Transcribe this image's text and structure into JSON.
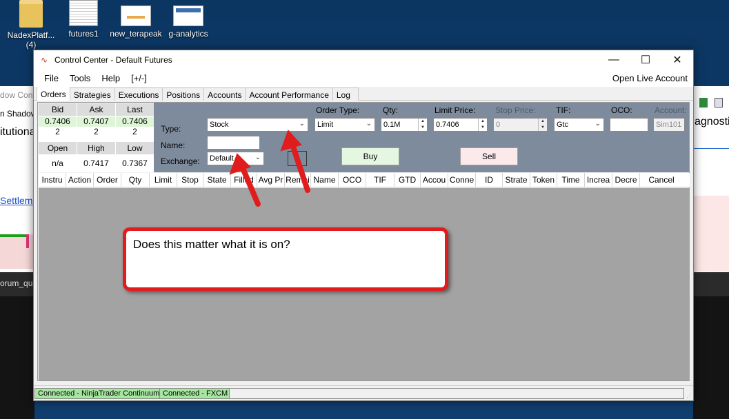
{
  "desktop": {
    "icons": [
      {
        "label": "NadexPlatf...",
        "sub": "(4)"
      },
      {
        "label": "futures1"
      },
      {
        "label": "new_terapeak"
      },
      {
        "label": "g-analytics"
      }
    ],
    "bg_left_texts": [
      "dow Con",
      "n Shadow",
      "itutional",
      "Settleme",
      "orum_qu"
    ],
    "bg_right_texts": [
      "agnosti"
    ]
  },
  "window": {
    "title": "Control Center - Default Futures",
    "menu": [
      "File",
      "Tools",
      "Help",
      "[+/-]"
    ],
    "menu_right": "Open Live Account",
    "tabs": [
      "Orders",
      "Strategies",
      "Executions",
      "Positions",
      "Accounts",
      "Account Performance",
      "Log"
    ],
    "active_tab": "Orders"
  },
  "quote": {
    "headers1": [
      "Bid",
      "Ask",
      "Last"
    ],
    "prices": [
      "0.7406",
      "0.7407",
      "0.7406"
    ],
    "sizes": [
      "2",
      "2",
      "2"
    ],
    "headers2": [
      "Open",
      "High",
      "Low"
    ],
    "values2": [
      "n/a",
      "0.7417",
      "0.7367"
    ]
  },
  "order": {
    "type_label": "Type:",
    "type_value": "Stock",
    "name_label": "Name:",
    "name_value": "",
    "exchange_label": "Exchange:",
    "exchange_value": "Default",
    "order_type_label": "Order Type:",
    "order_type_value": "Limit",
    "qty_label": "Qty:",
    "qty_value": "0.1M",
    "limit_price_label": "Limit Price:",
    "limit_price_value": "0.7406",
    "stop_price_label": "Stop Price:",
    "stop_price_value": "0",
    "tif_label": "TIF:",
    "tif_value": "Gtc",
    "oco_label": "OCO:",
    "oco_value": "",
    "account_label": "Account:",
    "account_value": "Sim101",
    "buy_label": "Buy",
    "sell_label": "Sell"
  },
  "grid_columns": [
    "Instru",
    "Action",
    "Order",
    "Qty",
    "Limit",
    "Stop",
    "State",
    "Filled",
    "Avg Pr",
    "Remai",
    "Name",
    "OCO",
    "TIF",
    "GTD",
    "Accou",
    "Conne",
    "ID",
    "Strate",
    "Token",
    "Time",
    "Increa",
    "Decre",
    "Cancel"
  ],
  "status": {
    "conn1": "Connected - NinjaTrader Continuum",
    "conn2": "Connected - FXCM"
  },
  "annotation": {
    "text": "Does this matter what it is on?"
  },
  "colors": {
    "annotation_red": "#e01c1c",
    "order_panel": "#7e8b9c",
    "status_green": "#a6e6a0",
    "buy_bg": "#e6f7e1",
    "sell_bg": "#fbe9ec"
  }
}
